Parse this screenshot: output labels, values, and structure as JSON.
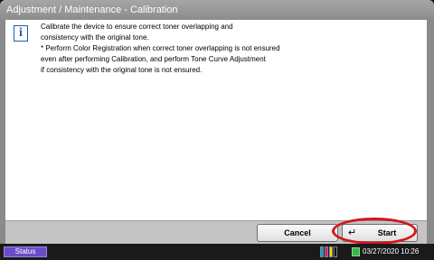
{
  "window": {
    "title": "Adjustment / Maintenance - Calibration"
  },
  "message": {
    "icon": "info-icon",
    "lines": [
      "Calibrate the device to ensure correct toner overlapping and",
      "consistency with the original tone.",
      "* Perform Color Registration when correct toner overlapping is not ensured",
      "even after performing Calibration, and perform Tone Curve Adjustment",
      "if consistency with the original tone is not ensured."
    ]
  },
  "buttons": {
    "cancel_label": "Cancel",
    "start_label": "Start",
    "start_icon": "enter-icon"
  },
  "status_bar": {
    "status_label": "Status",
    "datetime": "03/27/2020 10:26",
    "toner_icon": "toner-level-icon",
    "toner_colors": [
      "#00a0e0",
      "#e0007a",
      "#f0e000",
      "#000000"
    ]
  },
  "colors": {
    "status_button": "#6a4cc9",
    "highlight": "#d6141c"
  }
}
